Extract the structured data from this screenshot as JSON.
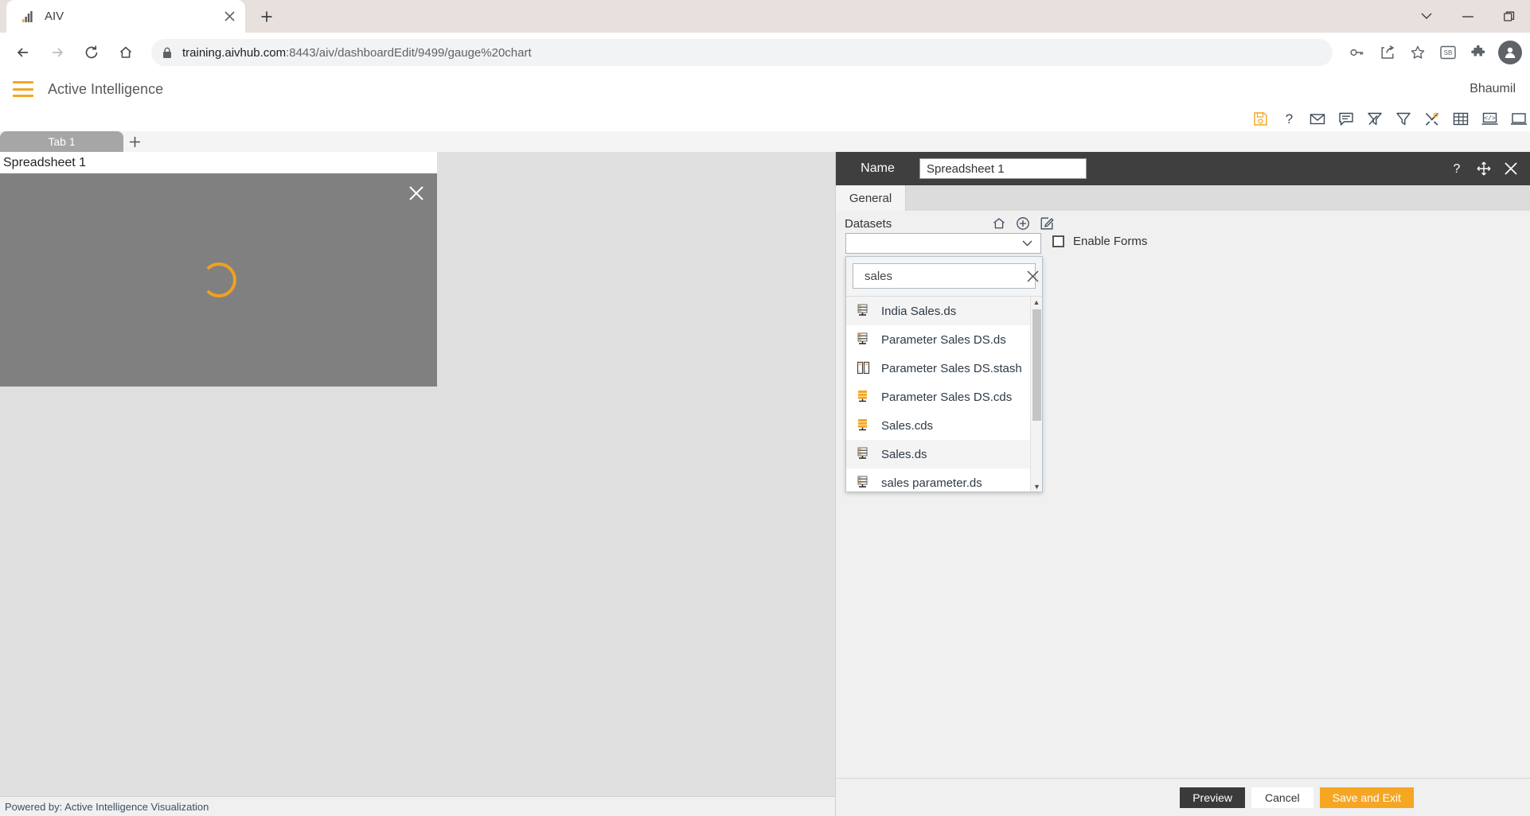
{
  "browser": {
    "tab": {
      "title": "AIV",
      "favicon_icon": "aiv-bars-icon",
      "close_icon": "close-icon"
    },
    "new_tab_icon": "plus-icon",
    "window_controls": [
      {
        "name": "chevron-down-icon",
        "glyph": "⌄"
      },
      {
        "name": "minimize-icon",
        "glyph": "—"
      },
      {
        "name": "restore-icon",
        "glyph": "❐"
      }
    ],
    "nav": {
      "back_icon": "back-arrow-icon",
      "forward_icon": "forward-arrow-icon",
      "reload_icon": "reload-icon",
      "home_icon": "home-icon"
    },
    "omnibox": {
      "lock_icon": "lock-icon",
      "url_host": "training.aivhub.com",
      "url_path": ":8443/aiv/dashboardEdit/9499/gauge%20chart",
      "url_full": "training.aivhub.com:8443/aiv/dashboardEdit/9499/gauge%20chart"
    },
    "toolbar_icons": [
      {
        "name": "key-icon"
      },
      {
        "name": "share-icon"
      },
      {
        "name": "bookmark-star-icon"
      },
      {
        "name": "extension-badge-icon"
      },
      {
        "name": "puzzle-extensions-icon"
      },
      {
        "name": "profile-avatar-icon"
      }
    ]
  },
  "app": {
    "menu_icon": "hamburger-menu-icon",
    "title": "Active Intelligence",
    "user": "Bhaumil",
    "icon_bar": [
      {
        "name": "save-icon",
        "glyph": "save"
      },
      {
        "name": "help-icon",
        "glyph": "?"
      },
      {
        "name": "mail-icon",
        "glyph": "mail"
      },
      {
        "name": "comment-icon",
        "glyph": "comment"
      },
      {
        "name": "clear-filter-icon",
        "glyph": "clear-filter"
      },
      {
        "name": "filter-icon",
        "glyph": "filter"
      },
      {
        "name": "tools-icon",
        "glyph": "tools"
      },
      {
        "name": "table-icon",
        "glyph": "table"
      },
      {
        "name": "code-view-icon",
        "glyph": "code"
      },
      {
        "name": "laptop-icon",
        "glyph": "laptop"
      }
    ],
    "sheet_tab": "Tab 1",
    "add_tab_icon": "plus-icon",
    "widget": {
      "title": "Spreadsheet 1",
      "close_icon": "close-icon",
      "loading_icon": "loading-spinner-icon"
    },
    "status": "Powered by: Active Intelligence Visualization"
  },
  "panel": {
    "name_label": "Name",
    "name_value": "Spreadsheet 1",
    "header_icons": [
      {
        "name": "help-icon",
        "glyph": "?"
      },
      {
        "name": "move-icon",
        "glyph": "move"
      },
      {
        "name": "close-icon",
        "glyph": "×"
      }
    ],
    "tabs": [
      {
        "label": "General",
        "active": true
      }
    ],
    "datasets": {
      "label": "Datasets",
      "icons": [
        {
          "name": "home-icon"
        },
        {
          "name": "add-circle-icon"
        },
        {
          "name": "edit-icon"
        }
      ],
      "selected_value": "",
      "chevron_icon": "chevron-down-icon"
    },
    "enable_forms": {
      "label": "Enable Forms",
      "checked": false
    },
    "dropdown": {
      "search_value": "sales",
      "search_placeholder": "",
      "clear_icon": "clear-x-icon",
      "scroll_up_icon": "scroll-up-arrow-icon",
      "scroll_down_icon": "scroll-down-arrow-icon",
      "items": [
        {
          "label": "India Sales.ds",
          "icon": "dataset-ds-icon",
          "highlighted": true
        },
        {
          "label": "Parameter Sales DS.ds",
          "icon": "dataset-ds-icon",
          "highlighted": false
        },
        {
          "label": "Parameter Sales DS.stash",
          "icon": "dataset-stash-icon",
          "highlighted": false
        },
        {
          "label": "Parameter Sales DS.cds",
          "icon": "dataset-cds-icon",
          "highlighted": false
        },
        {
          "label": "Sales.cds",
          "icon": "dataset-cds-icon",
          "highlighted": false
        },
        {
          "label": "Sales.ds",
          "icon": "dataset-ds-icon",
          "highlighted": true
        },
        {
          "label": "sales parameter.ds",
          "icon": "dataset-ds-icon",
          "highlighted": false
        }
      ]
    },
    "buttons": {
      "preview": "Preview",
      "cancel": "Cancel",
      "save_and_exit": "Save and Exit"
    }
  },
  "colors": {
    "accent_orange": "#f5a623",
    "panel_dark": "#3f3f3f",
    "widget_gray": "#808080",
    "canvas_gray": "#e0e0e0"
  }
}
